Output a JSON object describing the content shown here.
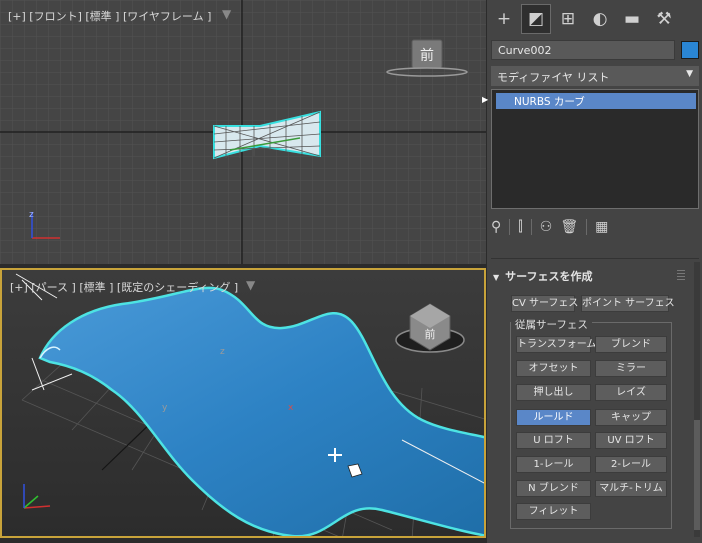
{
  "viewport_top": {
    "label": "[+] [フロント] [標準 ] [ワイヤフレーム ]",
    "viewcube_label": "前",
    "axis_z": "z"
  },
  "viewport_bottom": {
    "label": "[+] [パース ] [標準 ] [既定のシェーディング ]",
    "viewcube_label": "前",
    "axis_z": "z",
    "axis_y": "y",
    "axis_x": "x"
  },
  "command_panel": {
    "tabs": [
      {
        "icon": "create-icon",
        "glyph": "+"
      },
      {
        "icon": "modify-icon",
        "glyph": "◩"
      },
      {
        "icon": "hierarchy-icon",
        "glyph": "⊞"
      },
      {
        "icon": "motion-icon",
        "glyph": "◐"
      },
      {
        "icon": "display-icon",
        "glyph": "▬"
      },
      {
        "icon": "utilities-icon",
        "glyph": "⚒"
      }
    ],
    "object_name": "Curve002",
    "object_color": "#2a85d3",
    "modifier_list": "モディファイヤ リスト",
    "stack_item": "NURBS カーブ",
    "rollout_title": "サーフェスを作成",
    "buttons_top": [
      "CV サーフェス",
      "ポイント サーフェス"
    ],
    "group_label": "従属サーフェス",
    "dependent_buttons": [
      [
        "トランスフォーム",
        "ブレンド"
      ],
      [
        "オフセット",
        "ミラー"
      ],
      [
        "押し出し",
        "レイズ"
      ],
      [
        "ルールド",
        "キャップ"
      ],
      [
        "U ロフト",
        "UV ロフト"
      ],
      [
        "1-レール",
        "2-レール"
      ],
      [
        "N ブレンド",
        "マルチ-トリム"
      ],
      [
        "フィレット"
      ]
    ],
    "active_button": "ルールド"
  }
}
